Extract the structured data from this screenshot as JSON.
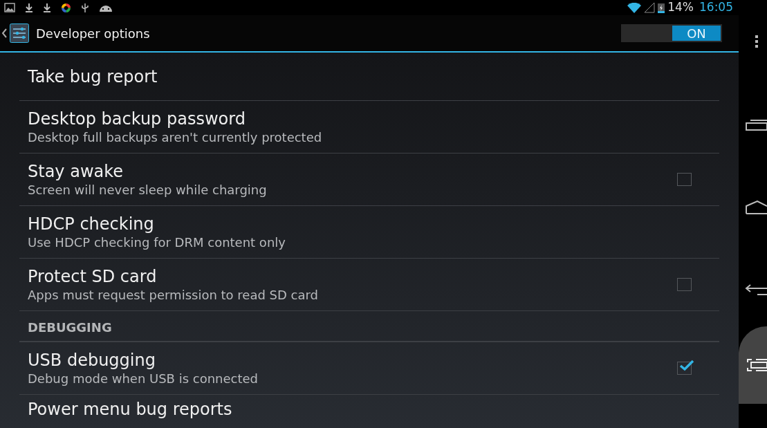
{
  "status_bar": {
    "battery": "14%",
    "time": "16:05"
  },
  "action_bar": {
    "title": "Developer options",
    "switch": {
      "label": "ON",
      "on": true
    }
  },
  "items": [
    {
      "kind": "simple",
      "title": "Take bug report"
    },
    {
      "kind": "text",
      "title": "Desktop backup password",
      "summary": "Desktop full backups aren't currently protected"
    },
    {
      "kind": "checkbox",
      "title": "Stay awake",
      "summary": "Screen will never sleep while charging",
      "checked": false
    },
    {
      "kind": "text",
      "title": "HDCP checking",
      "summary": "Use HDCP checking for DRM content only"
    },
    {
      "kind": "checkbox",
      "title": "Protect SD card",
      "summary": "Apps must request permission to read SD card",
      "checked": false
    },
    {
      "kind": "header",
      "title": "DEBUGGING"
    },
    {
      "kind": "checkbox",
      "title": "USB debugging",
      "summary": "Debug mode when USB is connected",
      "checked": true
    },
    {
      "kind": "simple",
      "title": "Power menu bug reports"
    }
  ]
}
